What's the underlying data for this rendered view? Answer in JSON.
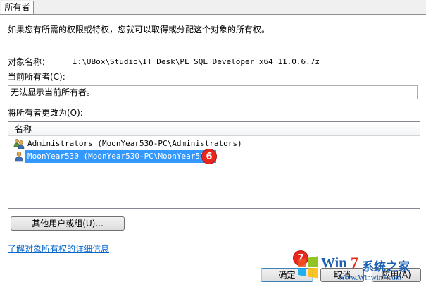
{
  "tab": {
    "label": "所有者"
  },
  "intro": "如果您有所需的权限或特权，您就可以取得或分配这个对象的所有权。",
  "object_name": {
    "label": "对象名称：",
    "value": "I:\\UBox\\Studio\\IT_Desk\\PL_SQL_Developer_x64_11.0.6.7z"
  },
  "current_owner": {
    "label": "当前所有者(C):",
    "value": "无法显示当前所有者。"
  },
  "change_owner": {
    "label": "将所有者更改为(O):",
    "column_header": "名称",
    "rows": [
      {
        "icon": "user-group-icon",
        "label": "Administrators (MoonYear530-PC\\Administrators)",
        "selected": false
      },
      {
        "icon": "user-icon",
        "label": "MoonYear530 (MoonYear530-PC\\MoonYear530)",
        "selected": true
      }
    ]
  },
  "annotations": {
    "step6": "6",
    "step7": "7"
  },
  "other_users_button": "其他用户或组(U)...",
  "learn_more_link": "了解对象所有权的详细信息",
  "footer": {
    "ok": "确定",
    "cancel": "取消",
    "apply": "应用(A)"
  },
  "watermark": {
    "brand_win": "Win",
    "brand_7": "7",
    "brand_suffix": "系统之家",
    "url": "Www.Winwin7.com"
  },
  "colors": {
    "selection": "#3399ff",
    "link": "#0066cc",
    "badge": "#e8261c"
  }
}
